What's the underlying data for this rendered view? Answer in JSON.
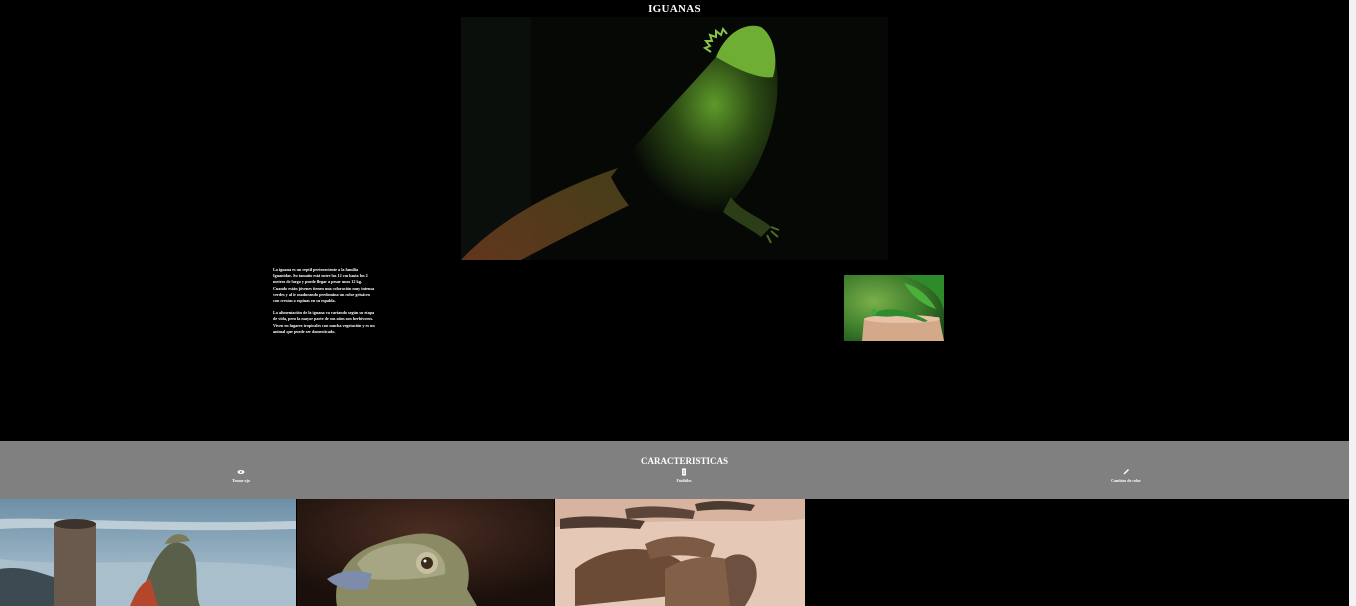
{
  "page": {
    "title": "IGUANAS"
  },
  "main": {
    "hero_image": "bearded-dragon-lizard-photo",
    "paragraphs": [
      "La iguana es un reptil perteneciente a la familia Iguanidae. Su tamaño está entre los 12 cm hasta los 2 metros de largo y puede llegar a pesar unos 12 kg. Cuando están jóvenes tienen una coloración muy intensa verdes y al ir madurando predomina un color grisáceo con crestas o espinas en su espalda.",
      "La alimentación de la iguana va variando según su etapa de vida, pero la mayor parte de sus años son herbívoros. Viven en lugares tropicales con mucha vegetación y es un animal que puede ser domesticado."
    ],
    "thumbnail_image": "green-lizard-on-stump-photo"
  },
  "features": {
    "title": "CARACTERISTICAS",
    "items": [
      {
        "label": "Tomar ojo",
        "icon": "eye-icon"
      },
      {
        "label": "Fósiltiles",
        "icon": "document-icon"
      },
      {
        "label": "Cambios de color",
        "icon": "pencil-icon"
      }
    ]
  },
  "gallery": {
    "images": [
      "iguana-on-beach-photo",
      "iguana-head-closeup-photo",
      "marine-iguanas-group-photo"
    ]
  },
  "colors": {
    "background": "#000000",
    "feature_bar": "#808080",
    "text": "#ffffff"
  }
}
